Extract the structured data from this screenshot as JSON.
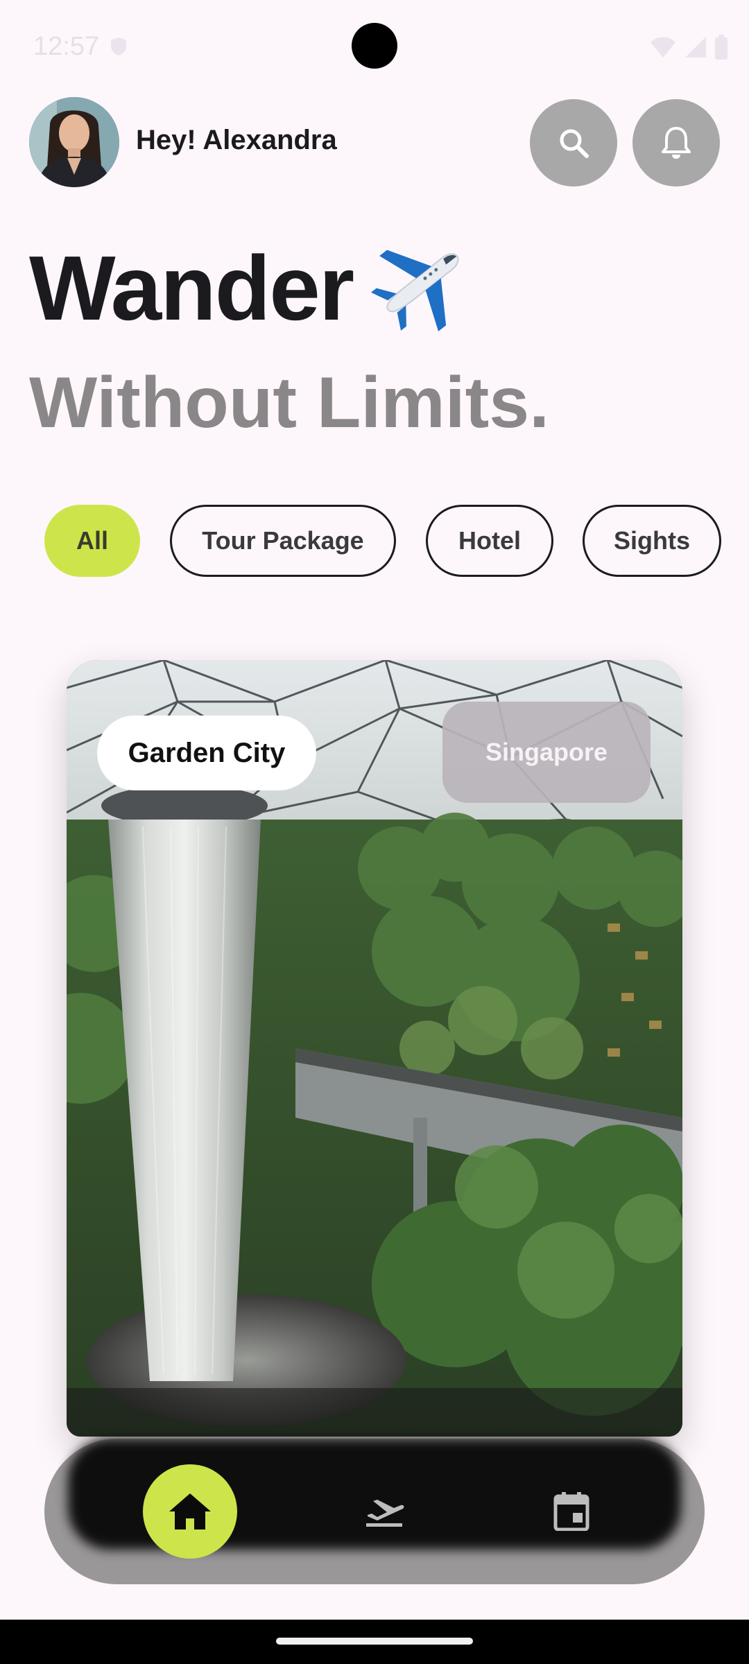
{
  "status_bar": {
    "time": "12:57"
  },
  "header": {
    "greeting": "Hey! Alexandra",
    "search_icon": "search-icon",
    "notification_icon": "bell-icon"
  },
  "hero": {
    "title_line1": "Wander",
    "title_emoji": "airplane-icon",
    "title_line2": "Without Limits."
  },
  "filters": {
    "items": [
      {
        "label": "All",
        "selected": true
      },
      {
        "label": "Tour Package",
        "selected": false
      },
      {
        "label": "Hotel",
        "selected": false
      },
      {
        "label": "Sights",
        "selected": false
      }
    ]
  },
  "card": {
    "name": "Garden City",
    "country": "Singapore"
  },
  "bottom_nav": {
    "items": [
      {
        "icon": "home-icon",
        "active": true
      },
      {
        "icon": "flight-takeoff-icon",
        "active": false
      },
      {
        "icon": "calendar-icon",
        "active": false
      }
    ]
  },
  "colors": {
    "accent": "#cde54a",
    "background": "#fdf6fb",
    "text_primary": "#1b1b1f",
    "text_secondary": "#8a8789"
  }
}
